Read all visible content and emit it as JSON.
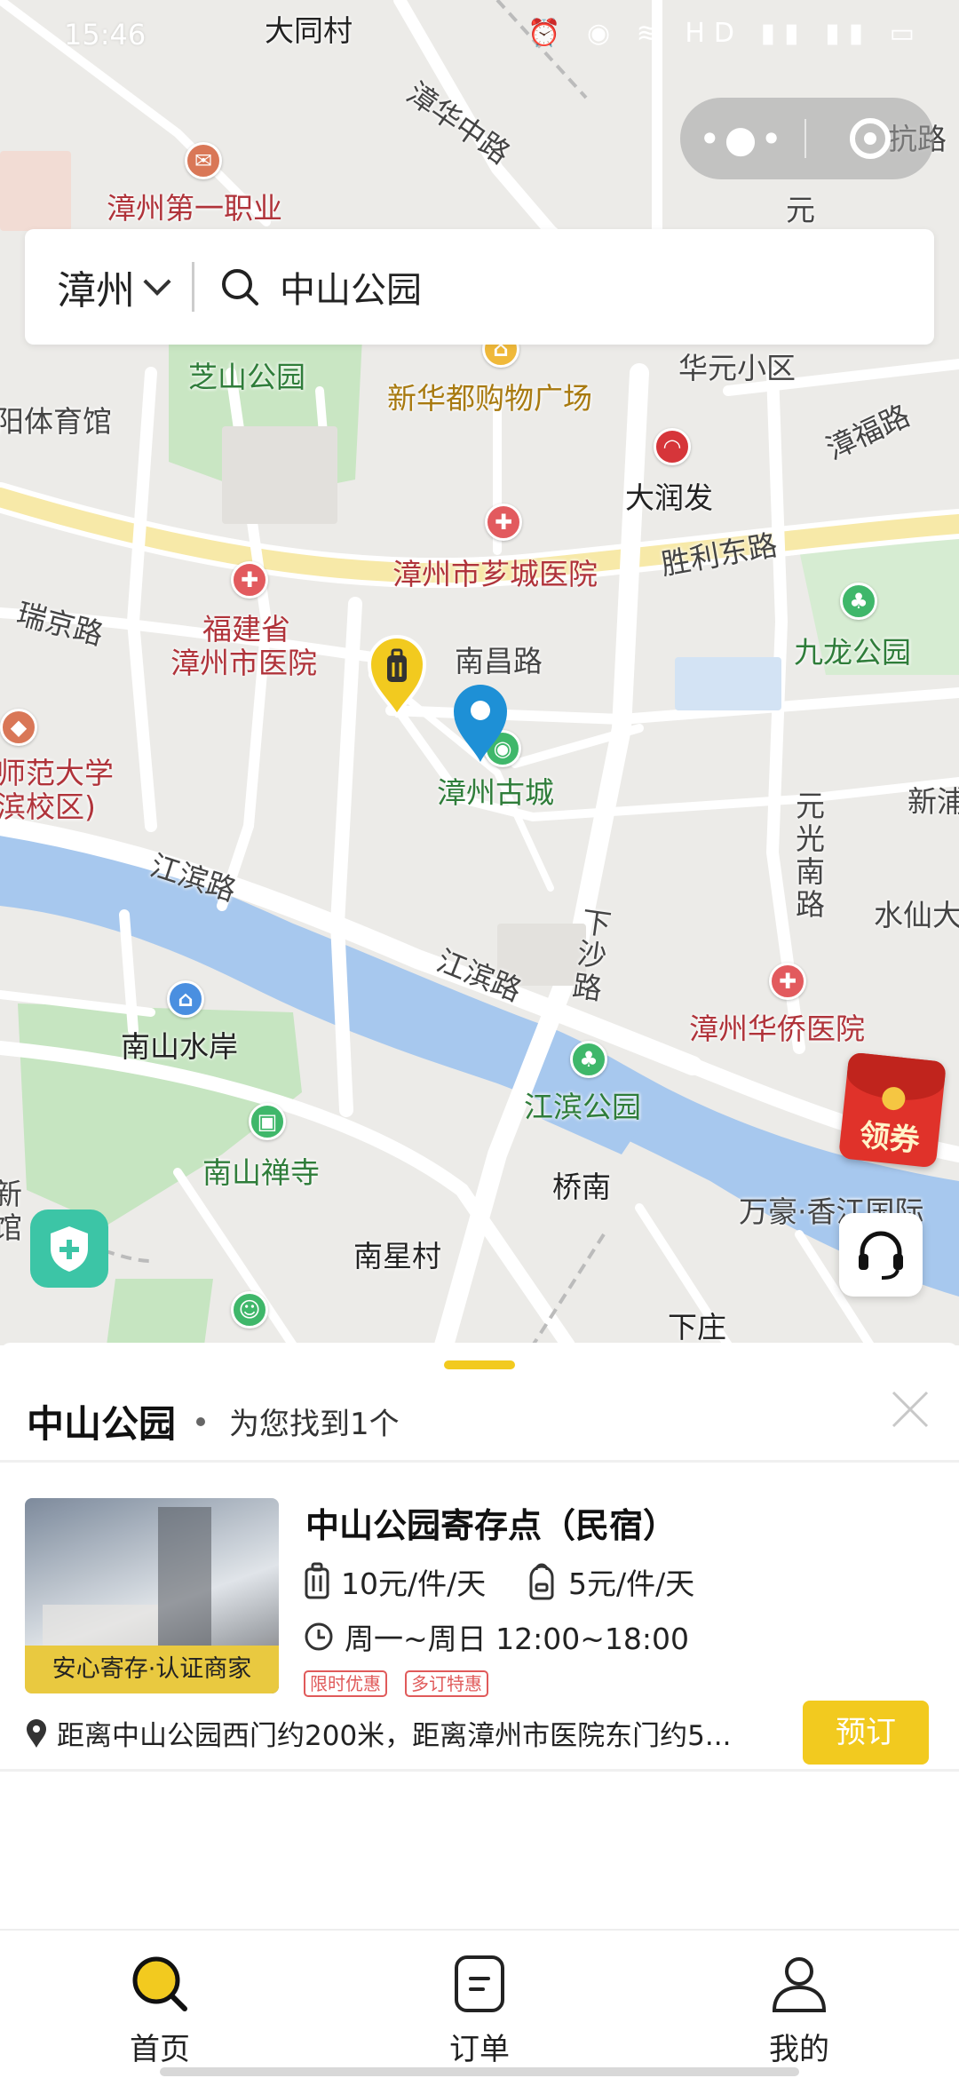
{
  "status_bar": {
    "time": "15:46",
    "icons": "⏰ ◉ ≋ HD ▮▮ ▮▮ ▭"
  },
  "capsule": {
    "more_label": "•●•",
    "close_icon": "target-ring-icon"
  },
  "search": {
    "city": "漳州",
    "query": "中山公园"
  },
  "map": {
    "labels": {
      "datongcun": "大同村",
      "zhanghua_zhonglu": "漳华中路",
      "xx_lu": "抗路",
      "zhangzhou_vocational": "漳州第一职业",
      "yuan": "元",
      "zhishan_park": "芝山公园",
      "xinhuadu": "新华都购物广场",
      "huayuan": "华元小区",
      "zhangfu_lu": "漳福路",
      "tiyuguan": "阳体育馆",
      "darunfa": "大润发",
      "shengli_donglu": "胜利东路",
      "xiangcheng_hospital": "漳州市芗城医院",
      "ruijing_lu": "瑞京路",
      "fujian_hospital_1": "福建省",
      "fujian_hospital_2": "漳州市医院",
      "nanchang_lu": "南昌路",
      "jiulong_park": "九龙公园",
      "normal_univ_1": "师范大学",
      "normal_univ_2": "滨校区)",
      "ancient_city": "漳州古城",
      "yuanguang_nanlu": "元光南路",
      "xinpu": "新浦",
      "jiangbin_lu_1": "江滨路",
      "shuixian": "水仙大",
      "xiasha_lu": "下沙路",
      "jiangbin_lu_2": "江滨路",
      "overseas_hospital": "漳州华侨医院",
      "nanshan_shuian": "南山水岸",
      "jiangbin_park": "江滨公园",
      "nanshan_temple": "南山禅寺",
      "qiaonan": "桥南",
      "wanhao": "万豪·香江国际",
      "xinguan": "新馆",
      "nanxingcun": "南星村",
      "xiazhuang": "下庄"
    }
  },
  "coupon": {
    "label": "领券"
  },
  "sheet": {
    "title": "中山公园",
    "count_text": "为您找到1个",
    "store": {
      "name": "中山公园寄存点（民宿）",
      "badge": "安心寄存·认证商家",
      "price_luggage": "10元/件/天",
      "price_bag": "5元/件/天",
      "hours": "周一~周日 12:00~18:00",
      "tags": [
        "限时优惠",
        "多订特惠"
      ],
      "distance": "距离中山公园西门约200米，距离漳州市医院东门约5...",
      "book_label": "预订"
    }
  },
  "tabs": [
    {
      "label": "首页",
      "icon": "search-icon",
      "active": true
    },
    {
      "label": "订单",
      "icon": "order-icon",
      "active": false
    },
    {
      "label": "我的",
      "icon": "user-icon",
      "active": false
    }
  ],
  "colors": {
    "accent": "#f2ca1f",
    "water": "#a7c8ee",
    "park": "#c6e5c1",
    "shield": "#3cc5a6",
    "marker_blue": "#1e90d6"
  }
}
